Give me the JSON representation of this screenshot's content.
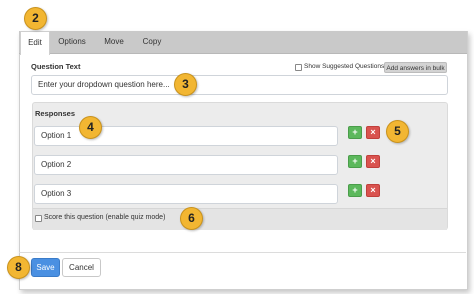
{
  "tabs": [
    {
      "label": "Edit",
      "active": true
    },
    {
      "label": "Options"
    },
    {
      "label": "Move"
    },
    {
      "label": "Copy"
    }
  ],
  "question": {
    "label": "Question Text",
    "placeholder": "Enter your dropdown question here...",
    "show_suggested_label": "Show Suggested Questions",
    "show_suggested_checked": false,
    "bulk_button_label": "Add answers in bulk"
  },
  "responses": {
    "label": "Responses",
    "options": [
      {
        "value": "Option 1"
      },
      {
        "value": "Option 2"
      },
      {
        "value": "Option 3"
      }
    ],
    "add_glyph": "+",
    "delete_glyph": "×",
    "score_label": "Score this question (enable quiz mode)",
    "score_checked": false
  },
  "footer": {
    "save_label": "Save",
    "cancel_label": "Cancel"
  },
  "callouts": [
    "2",
    "3",
    "4",
    "5",
    "6",
    "8"
  ],
  "colors": {
    "callout": "#f2b632",
    "add_button": "#5cb85c",
    "delete_button": "#d9534f",
    "save_button": "#4a90e2",
    "tab_bar": "#c9c9c9"
  }
}
